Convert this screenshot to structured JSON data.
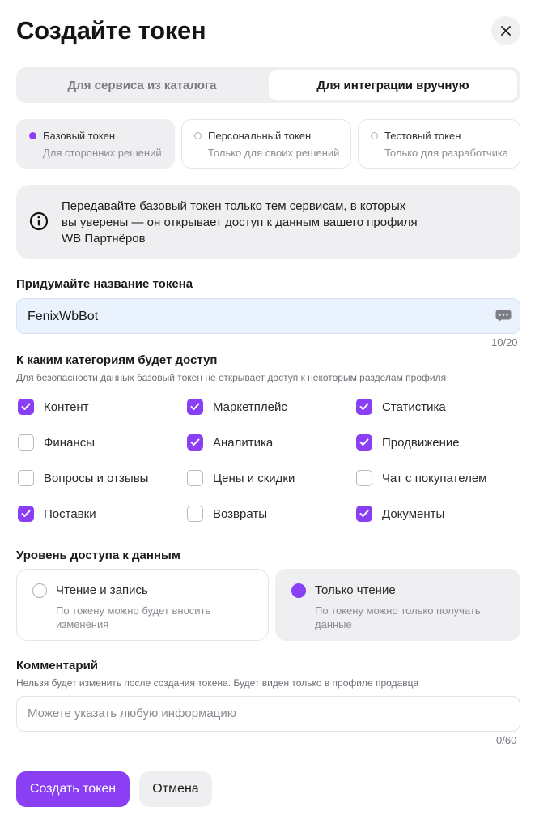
{
  "title": "Создайте токен",
  "tabs": [
    {
      "label": "Для сервиса из каталога",
      "active": false
    },
    {
      "label": "Для интеграции вручную",
      "active": true
    }
  ],
  "token_types": [
    {
      "title": "Базовый токен",
      "subtitle": "Для сторонних решений",
      "selected": true
    },
    {
      "title": "Персональный токен",
      "subtitle": "Только для своих решений",
      "selected": false
    },
    {
      "title": "Тестовый токен",
      "subtitle": "Только для разработчика",
      "selected": false
    }
  ],
  "info": {
    "line1": "Передавайте базовый токен только тем сервисам, в которых",
    "line2": "вы уверены — он открывает доступ к данным вашего профиля",
    "line3": "WB Партнёров",
    "icon": "info-icon"
  },
  "name_field": {
    "label": "Придумайте название токена",
    "value": "FenixWbBot",
    "counter": "10/20"
  },
  "categories": {
    "label": "К каким категориям будет доступ",
    "note": "Для безопасности данных базовый токен не открывает доступ к некоторым разделам профиля",
    "items": [
      {
        "label": "Контент",
        "checked": true
      },
      {
        "label": "Маркетплейс",
        "checked": true
      },
      {
        "label": "Статистика",
        "checked": true
      },
      {
        "label": "Финансы",
        "checked": false
      },
      {
        "label": "Аналитика",
        "checked": true
      },
      {
        "label": "Продвижение",
        "checked": true
      },
      {
        "label": "Вопросы и отзывы",
        "checked": false
      },
      {
        "label": "Цены и скидки",
        "checked": false
      },
      {
        "label": "Чат с покупателем",
        "checked": false
      },
      {
        "label": "Поставки",
        "checked": true
      },
      {
        "label": "Возвраты",
        "checked": false
      },
      {
        "label": "Документы",
        "checked": true
      }
    ]
  },
  "access_level": {
    "label": "Уровень доступа к данным",
    "options": [
      {
        "title": "Чтение и запись",
        "line1": "По токену можно будет вносить",
        "line2": "изменения",
        "selected": false
      },
      {
        "title": "Только чтение",
        "line1": "По токену можно только получать",
        "line2": "данные",
        "selected": true
      }
    ]
  },
  "comment": {
    "label": "Комментарий",
    "note": "Нельзя будет изменить после создания токена. Будет виден только в профиле продавца",
    "placeholder": "Можете указать любую информацию",
    "counter": "0/60"
  },
  "buttons": {
    "create": "Создать токен",
    "cancel": "Отмена"
  },
  "colors": {
    "accent": "#8b3ff5",
    "surface": "#efeff2"
  }
}
